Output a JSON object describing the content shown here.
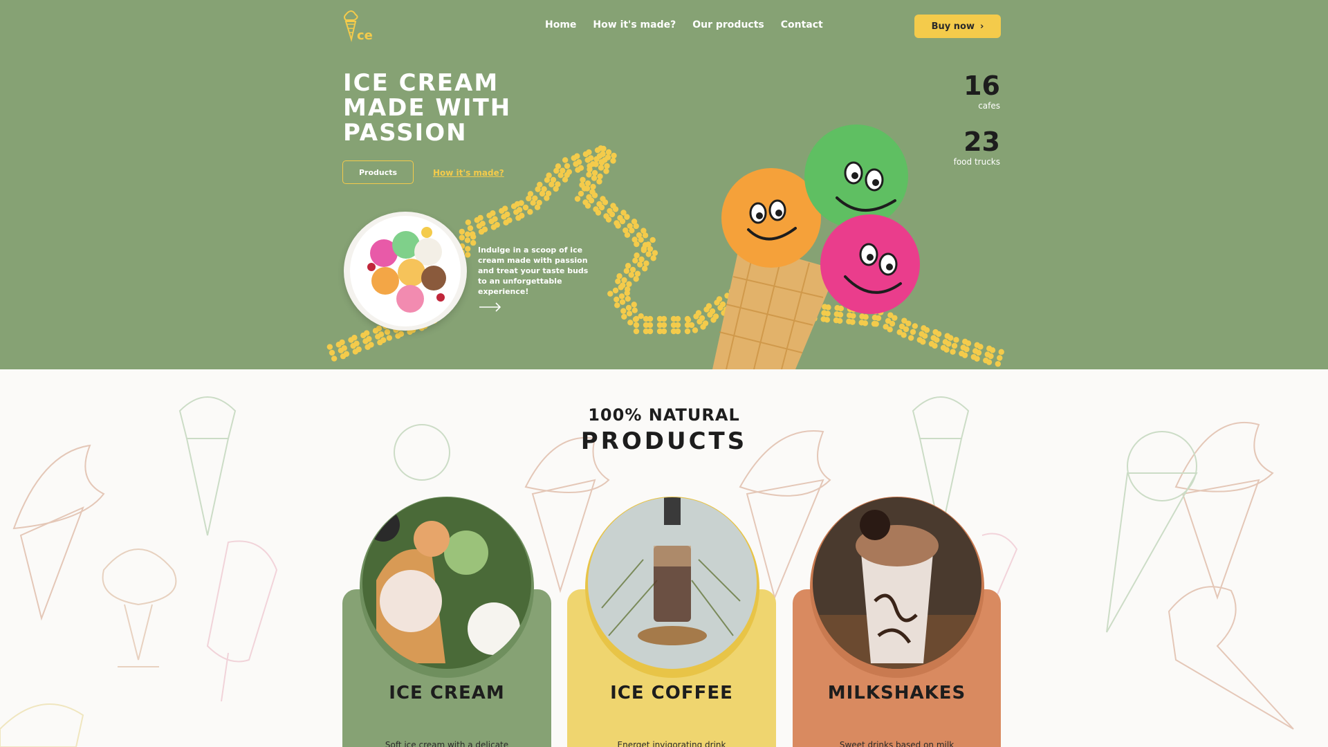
{
  "header": {
    "logo_text": "ce",
    "nav": [
      "Home",
      "How it's made?",
      "Our products",
      "Contact"
    ],
    "buy_label": "Buy now"
  },
  "hero": {
    "headline": [
      "ICE CREAM",
      "MADE WITH",
      "PASSION"
    ],
    "products_button": "Products",
    "how_link": "How it's made?",
    "description": "Indulge in a scoop of ice cream made with passion and treat your taste buds to an unforgettable experience!",
    "stats": [
      {
        "value": "16",
        "label": "cafes"
      },
      {
        "value": "23",
        "label": "food trucks"
      }
    ]
  },
  "products": {
    "subtitle": "100% NATURAL",
    "title": "PRODUCTS",
    "cards": [
      {
        "title": "ICE CREAM",
        "text": "Soft ice cream with a delicate",
        "color": "#86a274"
      },
      {
        "title": "ICE COFFEE",
        "text": "Energet invigorating drink",
        "color": "#efd56f"
      },
      {
        "title": "MILKSHAKES",
        "text": "Sweet drinks based on milk",
        "color": "#d98a60"
      }
    ]
  },
  "colors": {
    "hero_bg": "#86a274",
    "accent_yellow": "#f4cb4b",
    "page_bg": "#fbfaf8"
  }
}
